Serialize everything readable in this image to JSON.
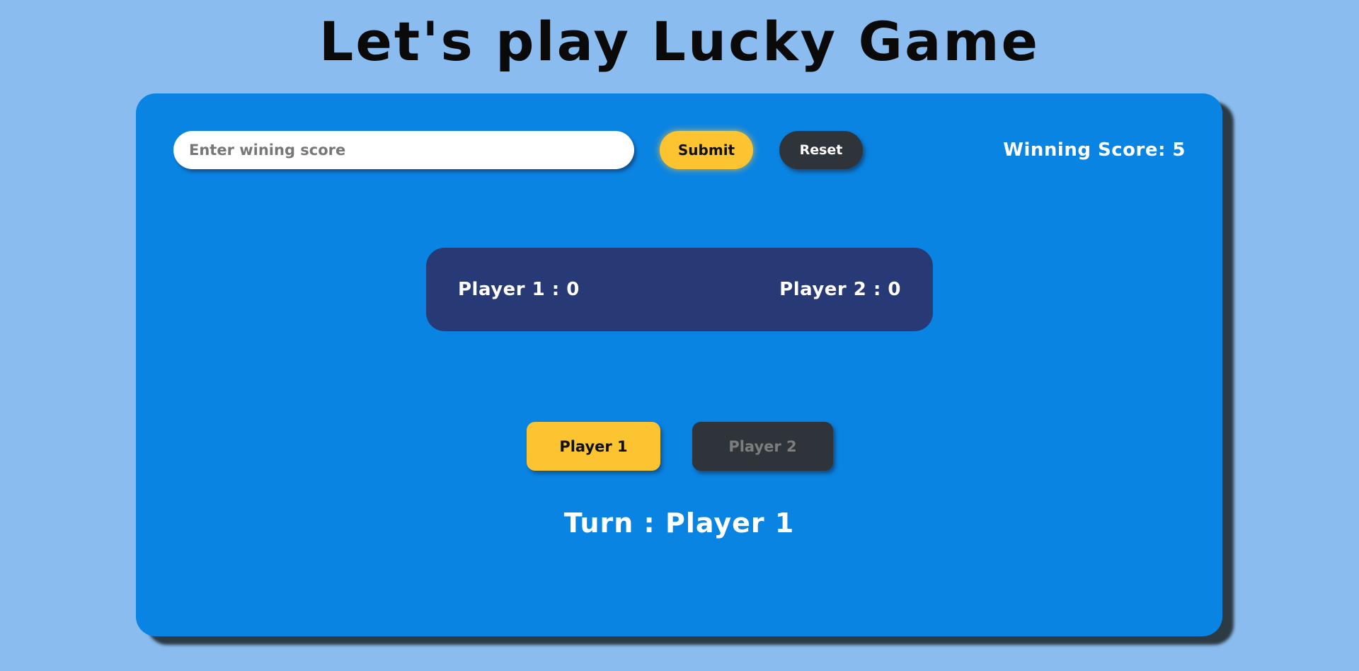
{
  "header": {
    "title": "Let's play Lucky Game"
  },
  "controls": {
    "score_input_placeholder": "Enter wining score",
    "score_input_value": "",
    "submit_label": "Submit",
    "reset_label": "Reset",
    "winning_score_text": "Winning Score: 5"
  },
  "scoreboard": {
    "player1_text": "Player 1 : 0",
    "player2_text": "Player 2 : 0"
  },
  "players": {
    "player1_label": "Player 1",
    "player2_label": "Player 2"
  },
  "turn": {
    "text": "Turn : Player 1"
  },
  "colors": {
    "page_background": "#8bbcf0",
    "card_background": "#0a84e3",
    "accent_yellow": "#fbc430",
    "dark_button": "#2e343a",
    "scoreboard_background": "#273a76"
  }
}
